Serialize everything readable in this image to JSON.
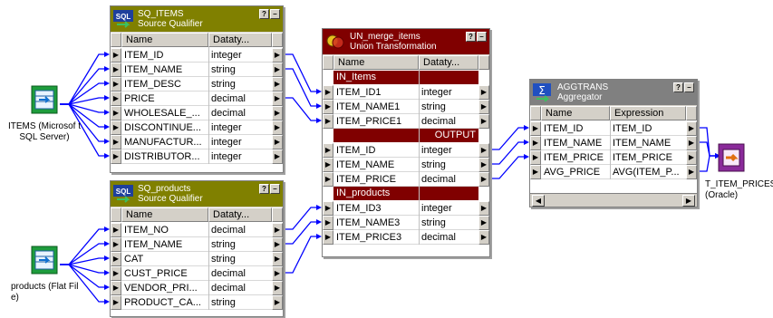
{
  "sources": [
    {
      "label": "ITEMS (Microsof t\nSQL Server)",
      "icon": "source-table-icon"
    },
    {
      "label": "products (Flat Fil\ne)",
      "icon": "source-file-icon"
    }
  ],
  "target": {
    "label": "T_ITEM_PRICES\n(Oracle)",
    "icon": "target-table-icon"
  },
  "sq_items": {
    "name": "SQ_ITEMS",
    "type": "Source Qualifier",
    "icon_text": "SQL",
    "columns": [
      "Name",
      "Dataty..."
    ],
    "rows": [
      [
        "ITEM_ID",
        "integer"
      ],
      [
        "ITEM_NAME",
        "string"
      ],
      [
        "ITEM_DESC",
        "string"
      ],
      [
        "PRICE",
        "decimal"
      ],
      [
        "WHOLESALE_...",
        "decimal"
      ],
      [
        "DISCONTINUE...",
        "integer"
      ],
      [
        "MANUFACTUR...",
        "integer"
      ],
      [
        "DISTRIBUTOR...",
        "integer"
      ]
    ]
  },
  "sq_products": {
    "name": "SQ_products",
    "type": "Source Qualifier",
    "icon_text": "SQL",
    "columns": [
      "Name",
      "Dataty..."
    ],
    "rows": [
      [
        "ITEM_NO",
        "decimal"
      ],
      [
        "ITEM_NAME",
        "string"
      ],
      [
        "CAT",
        "string"
      ],
      [
        "CUST_PRICE",
        "decimal"
      ],
      [
        "VENDOR_PRI...",
        "decimal"
      ],
      [
        "PRODUCT_CA...",
        "string"
      ]
    ]
  },
  "union": {
    "name": "UN_merge_items",
    "type": "Union Transformation",
    "columns": [
      "Name",
      "Dataty..."
    ],
    "groups": [
      {
        "label": "IN_Items",
        "rows": [
          [
            "ITEM_ID1",
            "integer"
          ],
          [
            "ITEM_NAME1",
            "string"
          ],
          [
            "ITEM_PRICE1",
            "decimal"
          ]
        ]
      },
      {
        "label": "OUTPUT",
        "align": "right",
        "rows": [
          [
            "ITEM_ID",
            "integer"
          ],
          [
            "ITEM_NAME",
            "string"
          ],
          [
            "ITEM_PRICE",
            "decimal"
          ]
        ]
      },
      {
        "label": "IN_products",
        "rows": [
          [
            "ITEM_ID3",
            "integer"
          ],
          [
            "ITEM_NAME3",
            "string"
          ],
          [
            "ITEM_PRICE3",
            "decimal"
          ]
        ]
      }
    ]
  },
  "aggtrans": {
    "name": "AGGTRANS",
    "type": "Aggregator",
    "columns": [
      "Name",
      "Expression"
    ],
    "rows": [
      [
        "ITEM_ID",
        "ITEM_ID"
      ],
      [
        "ITEM_NAME",
        "ITEM_NAME"
      ],
      [
        "ITEM_PRICE",
        "ITEM_PRICE"
      ],
      [
        "AVG_PRICE",
        "AVG(ITEM_P..."
      ]
    ]
  },
  "colors": {
    "source_qualifier": "#808000",
    "union": "#800000",
    "aggregator": "#808080",
    "link": "#0000ff",
    "source_icon": "#1e9c3c",
    "target_icon": "#8a2a9a"
  }
}
